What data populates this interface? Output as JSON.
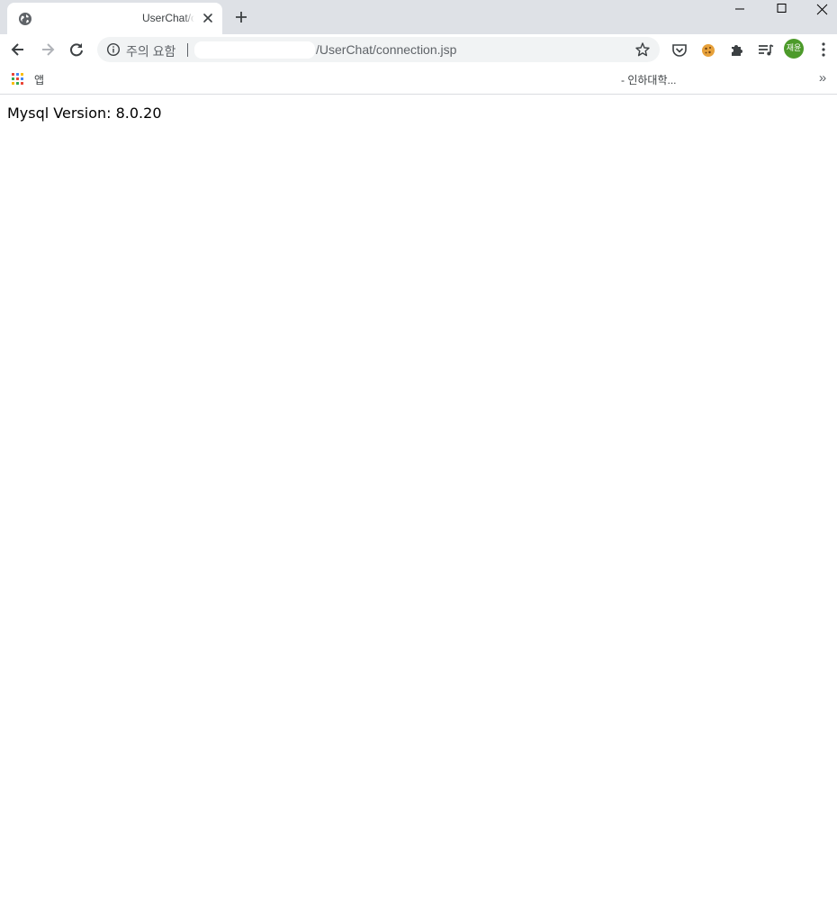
{
  "browser": {
    "tab": {
      "title": "UserChat/connection.jsp",
      "favicon": "globe-icon"
    },
    "toolbar": {
      "security_label": "주의 요함",
      "url_path": "/UserChat/connection.jsp"
    },
    "profile": {
      "initials": "재윤",
      "color": "#4c9a2a"
    },
    "bookmarks": {
      "apps_label": "앱",
      "folder_label": "- 인하대학...",
      "overflow_label": "»"
    }
  },
  "page": {
    "mysql_version_label": "Mysql Version: 8.0.20"
  }
}
